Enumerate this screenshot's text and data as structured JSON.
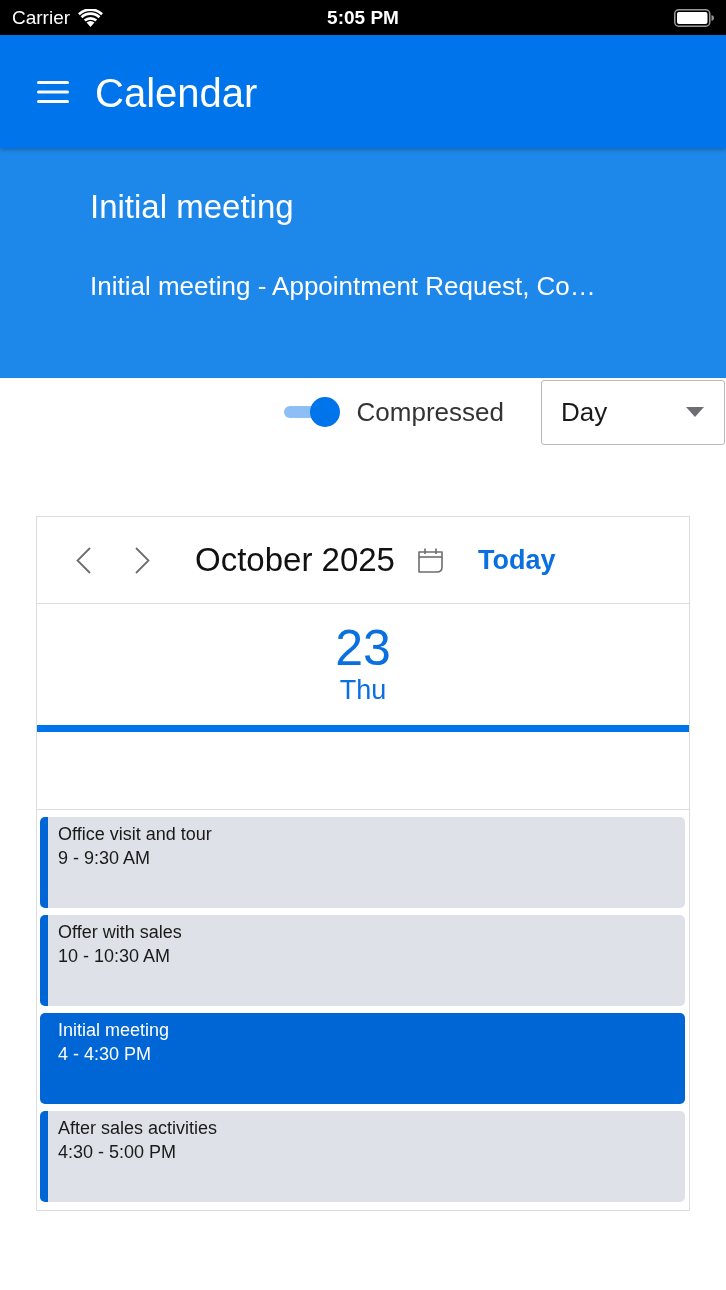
{
  "status_bar": {
    "carrier": "Carrier",
    "time": "5:05 PM"
  },
  "app_bar": {
    "title": "Calendar"
  },
  "detail": {
    "title": "Initial meeting",
    "subtitle": "Initial meeting - Appointment Request, Co…"
  },
  "toolbar": {
    "compressed_toggle": {
      "label": "Compressed",
      "on": true
    },
    "view_select": {
      "value": "Day"
    }
  },
  "calendar": {
    "month": "October 2025",
    "today_button": "Today",
    "day": {
      "number": "23",
      "weekday": "Thu"
    },
    "events": [
      {
        "title": "Office visit and tour",
        "time": "9 - 9:30 AM",
        "selected": false
      },
      {
        "title": "Offer with sales",
        "time": "10 - 10:30 AM",
        "selected": false
      },
      {
        "title": "Initial meeting",
        "time": "4 - 4:30 PM",
        "selected": true
      },
      {
        "title": "After sales activities",
        "time": "4:30 - 5:00 PM",
        "selected": false
      }
    ]
  }
}
